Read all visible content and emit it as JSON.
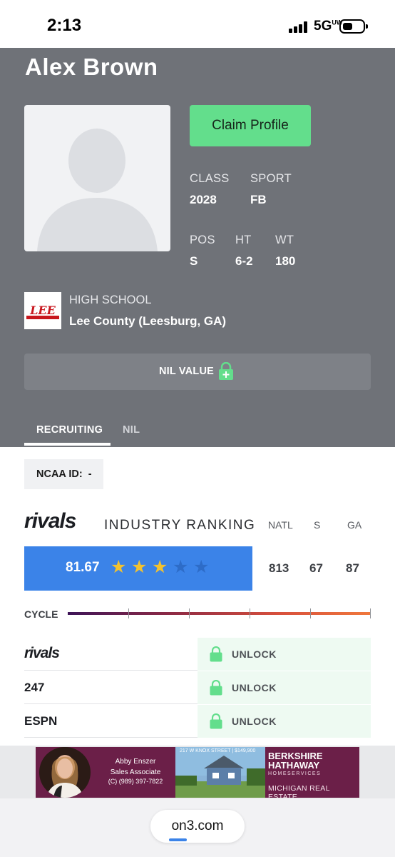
{
  "status_bar": {
    "time": "2:13",
    "network": "5G",
    "network_sup": "UW"
  },
  "profile": {
    "name": "Alex Brown",
    "claim_label": "Claim Profile",
    "class_label": "CLASS",
    "class_value": "2028",
    "sport_label": "SPORT",
    "sport_value": "FB",
    "pos_label": "POS",
    "pos_value": "S",
    "ht_label": "HT",
    "ht_value": "6-2",
    "wt_label": "WT",
    "wt_value": "180",
    "school_label": "HIGH SCHOOL",
    "school_name": "Lee County (Leesburg, GA)",
    "school_logo_text": "LEE",
    "nil_label": "NIL VALUE",
    "tabs": [
      "RECRUITING",
      "NIL"
    ]
  },
  "ncaa": {
    "label": "NCAA ID:",
    "value": "-"
  },
  "ranking": {
    "brand": "rivals",
    "title": "INDUSTRY RANKING",
    "headers": [
      "NATL",
      "S",
      "GA"
    ],
    "rating": "81.67",
    "stars": 3,
    "stars_max": 5,
    "values": [
      "813",
      "67",
      "87"
    ],
    "cycle_label": "CYCLE"
  },
  "services": [
    {
      "name": "rivals",
      "action": "UNLOCK"
    },
    {
      "name": "247",
      "action": "UNLOCK"
    },
    {
      "name": "ESPN",
      "action": "UNLOCK"
    }
  ],
  "ad": {
    "agent_name": "Abby Enszer",
    "agent_title": "Sales Associate",
    "agent_phone": "(C) (989) 397-7822",
    "address": "217 W KNOX STREET | $149,900",
    "brand_line1": "BERKSHIRE",
    "brand_line2": "HATHAWAY",
    "brand_sub": "HOMESERVICES",
    "region": "MICHIGAN REAL ESTATE"
  },
  "browser": {
    "url": "on3.com"
  },
  "colors": {
    "accent": "#3b83e8",
    "claim": "#63de8c",
    "header_bg": "#6f7278",
    "star_on": "#f2c230",
    "star_off": "#2d6cc8"
  }
}
